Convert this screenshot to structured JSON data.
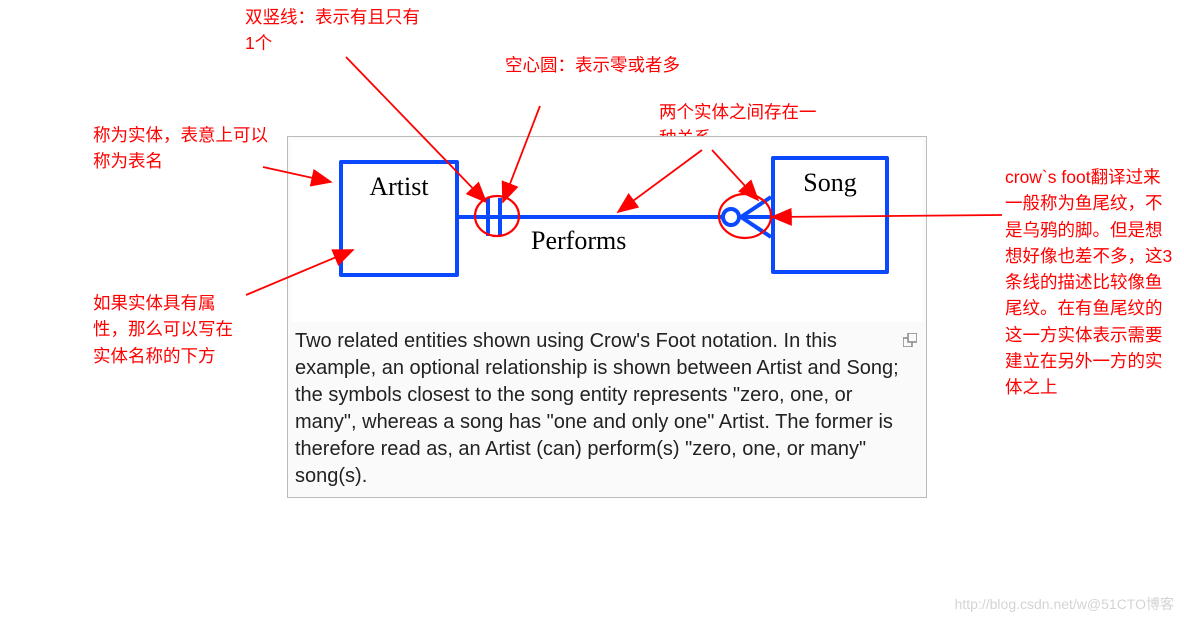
{
  "diagram": {
    "entity1": "Artist",
    "entity2": "Song",
    "relationship": "Performs",
    "caption": "Two related entities shown using Crow's Foot notation. In this example, an optional relationship is shown between Artist and Song; the symbols closest to the song entity represents \"zero, one, or many\", whereas a song has \"one and only one\" Artist. The former is therefore read as, an Artist (can) perform(s) \"zero, one, or many\" song(s)."
  },
  "annotations": {
    "double_bar": "双竖线：表示有且只有1个",
    "empty_circle": "空心圆：表示零或者多",
    "relation": "两个实体之间存在一种关系",
    "entity_name": "称为实体，表意上可以称为表名",
    "attributes": "如果实体具有属性，那么可以写在实体名称的下方",
    "crows_foot": "crow`s foot翻译过来一般称为鱼尾纹，不是乌鸦的脚。但是想想好像也差不多，这3条线的描述比较像鱼尾纹。在有鱼尾纹的这一方实体表示需要建立在另外一方的实体之上"
  },
  "watermark": "http://blog.csdn.net/w@51CTO博客"
}
